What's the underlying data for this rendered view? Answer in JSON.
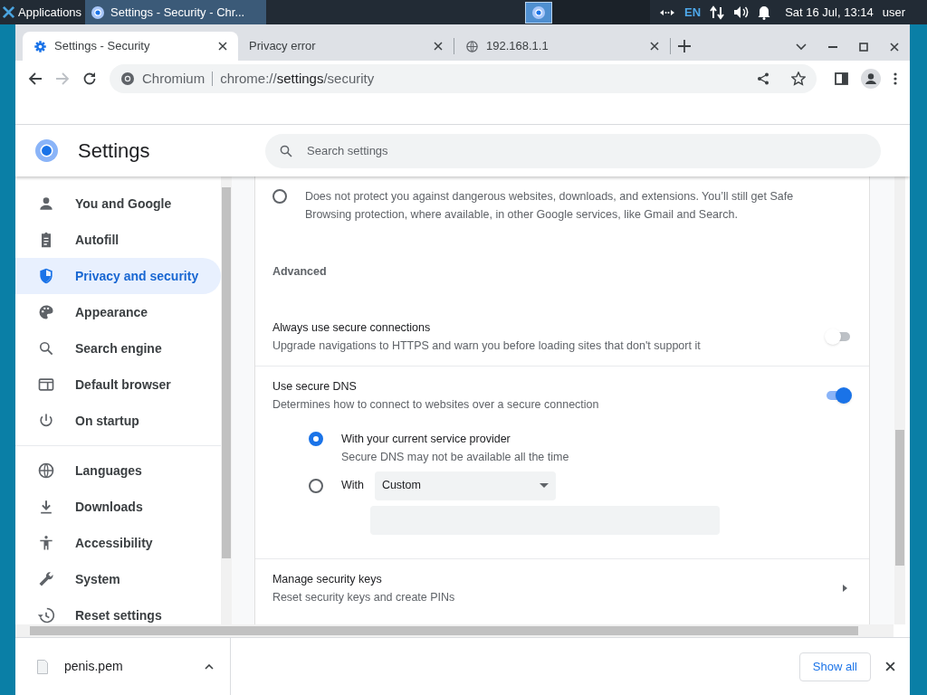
{
  "taskbar": {
    "apps_menu": "Applications",
    "task": "Settings - Security - Chr...",
    "keyboard": "EN",
    "clock": "Sat 16 Jul, 13:14",
    "user": "user"
  },
  "tabs": [
    {
      "title": "Settings - Security",
      "selected": true
    },
    {
      "title": "Privacy error",
      "selected": false
    },
    {
      "title": "192.168.1.1",
      "selected": false
    }
  ],
  "address_bar": {
    "site": "Chromium",
    "url_scheme": "chrome://",
    "url_host": "settings",
    "url_path": "/security"
  },
  "settings": {
    "title": "Settings",
    "search": {
      "placeholder": "Search settings"
    }
  },
  "sidebar": {
    "groups": [
      [
        {
          "label": "You and Google",
          "selected": false
        },
        {
          "label": "Autofill",
          "selected": false
        },
        {
          "label": "Privacy and security",
          "selected": true
        },
        {
          "label": "Appearance",
          "selected": false
        },
        {
          "label": "Search engine",
          "selected": false
        },
        {
          "label": "Default browser",
          "selected": false
        },
        {
          "label": "On startup",
          "selected": false
        }
      ],
      [
        {
          "label": "Languages",
          "selected": false
        },
        {
          "label": "Downloads",
          "selected": false
        },
        {
          "label": "Accessibility",
          "selected": false
        },
        {
          "label": "System",
          "selected": false
        },
        {
          "label": "Reset settings",
          "selected": false
        }
      ]
    ]
  },
  "content": {
    "protection_option": {
      "description": "Does not protect you against dangerous websites, downloads, and extensions. You’ll still get Safe Browsing protection, where available, in other Google services, like Gmail and Search.",
      "selected": false
    },
    "section": "Advanced",
    "rows": [
      {
        "kind": "toggle",
        "title": "Always use secure connections",
        "subtitle": "Upgrade navigations to HTTPS and warn you before loading sites that don't support it",
        "on": false
      },
      {
        "kind": "toggle",
        "title": "Use secure DNS",
        "subtitle": "Determines how to connect to websites over a secure connection",
        "on": true,
        "options": [
          {
            "kind": "radio",
            "label": "With your current service provider",
            "subtitle": "Secure DNS may not be available all the time",
            "selected": true
          },
          {
            "kind": "custom",
            "label": "With",
            "dropdown": "Custom",
            "selected": false
          }
        ]
      },
      {
        "kind": "link",
        "title": "Manage security keys",
        "subtitle": "Reset security keys and create PINs"
      }
    ]
  },
  "download_bar": {
    "file": "penis.pem",
    "show_all": "Show all"
  }
}
